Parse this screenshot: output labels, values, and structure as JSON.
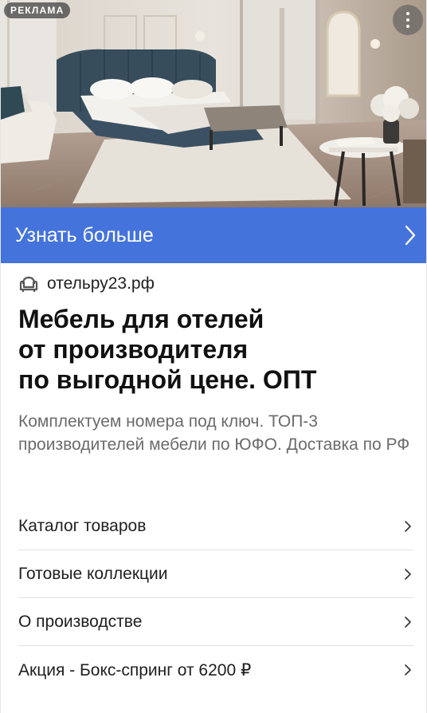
{
  "ad": {
    "badge_label": "РЕКЛАМА",
    "more_icon": "more-vertical-icon",
    "image_subject": "hotel-bedroom-interior-photo"
  },
  "cta": {
    "label": "Узнать больше",
    "icon": "chevron-right-icon",
    "color": "#4473db"
  },
  "advertiser": {
    "domain": "отельру23.рф",
    "favicon": "armchair-icon"
  },
  "title_lines": [
    "Мебель для отелей",
    "от производителя",
    "по выгодной цене. ОПТ"
  ],
  "description": "Комплектуем номера под ключ. ТОП-3 производителей мебели по ЮФО. Доставка по РФ",
  "sitelinks": [
    {
      "label": "Каталог товаров",
      "icon": "chevron-right-icon"
    },
    {
      "label": "Готовые коллекции",
      "icon": "chevron-right-icon"
    },
    {
      "label": "О производстве",
      "icon": "chevron-right-icon"
    },
    {
      "label": "Акция - Бокс-спринг от 6200 ₽",
      "icon": "chevron-right-icon"
    }
  ]
}
